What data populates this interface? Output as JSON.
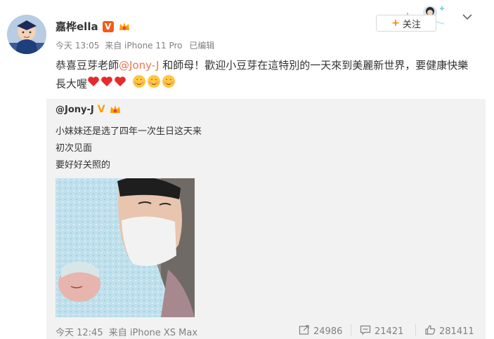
{
  "post": {
    "username": "嘉桦ella",
    "verified_badge": "V",
    "timestamp": "今天 13:05",
    "source": "来自 iPhone 11 Pro",
    "edited": "已编辑",
    "text_before_mention": "恭喜豆芽老師",
    "mention": "@Jony-J",
    "text_after_mention": " 和師母！歡迎小豆芽在這特別的一天來到美麗新世界，要健康快樂長大喔",
    "emoji_hearts": [
      "heart-emoji",
      "heart-emoji",
      "heart-emoji"
    ],
    "emoji_faces": [
      "heart-face-emoji",
      "heart-face-emoji",
      "heart-face-emoji"
    ]
  },
  "follow_button": {
    "plus": "+",
    "label": "关注"
  },
  "repost": {
    "username": "@Jony-J",
    "verified_badge": "V",
    "lines": [
      "小妹妹还是选了四年一次生日这天来",
      "初次见面",
      "要好好关照的"
    ],
    "timestamp": "今天 12:45",
    "source": "来自 iPhone XS Max",
    "actions": {
      "repost_count": "24986",
      "comment_count": "21421",
      "like_count": "281411"
    }
  },
  "colors": {
    "accent_orange": "#ff8200",
    "mention": "#eb7350",
    "verified": "#f45b16",
    "repost_bg": "#f2f2f2"
  }
}
